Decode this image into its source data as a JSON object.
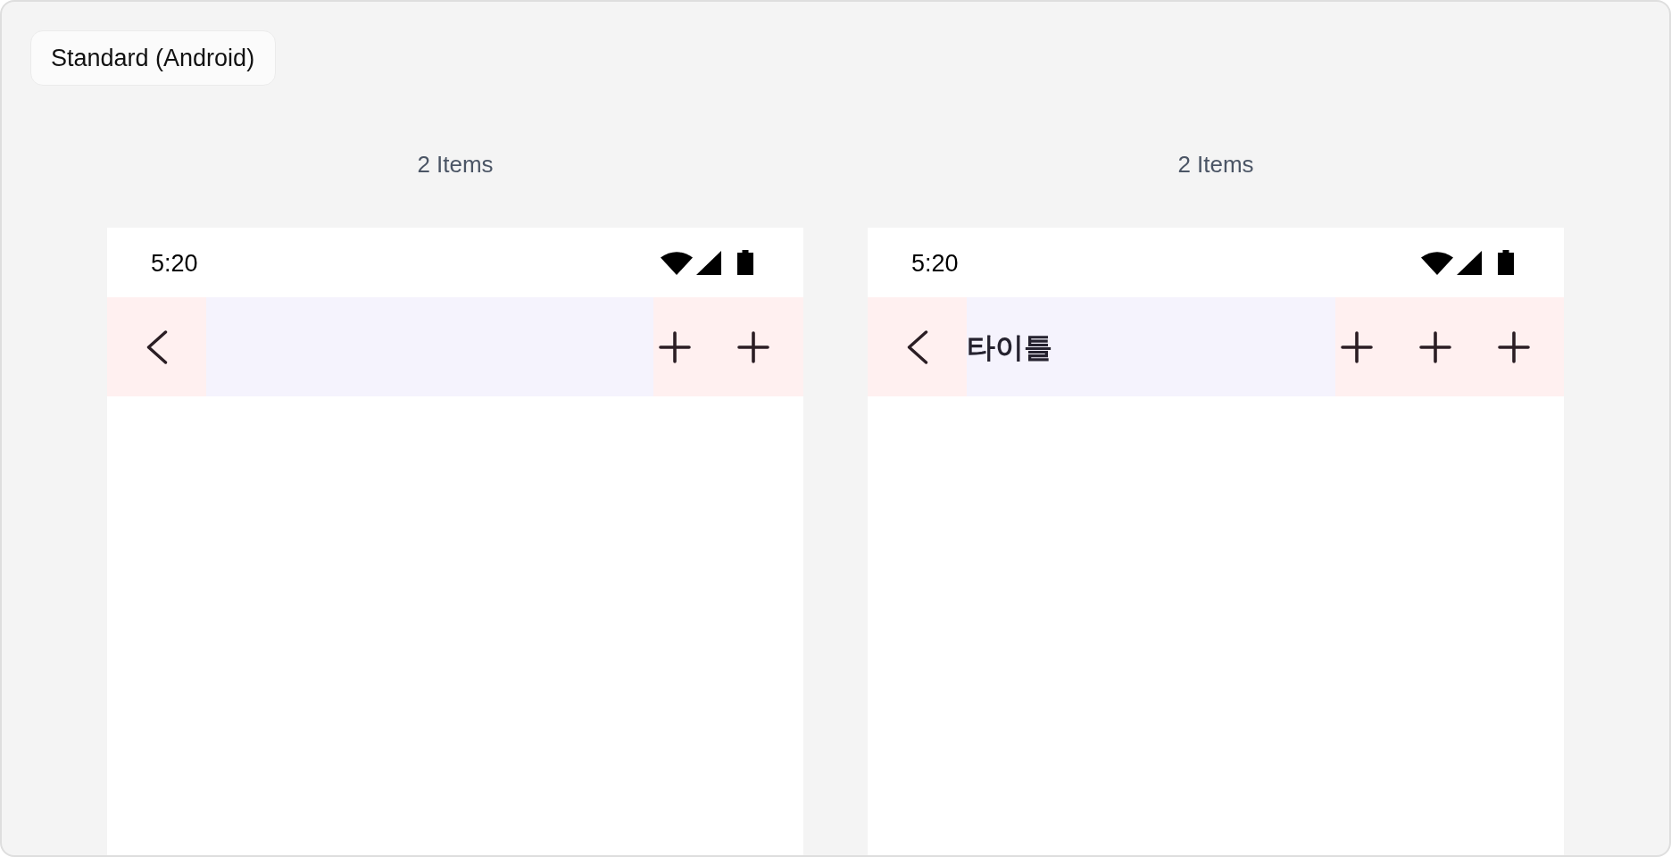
{
  "section_label": "Standard (Android)",
  "variants": [
    {
      "caption": "2 Items",
      "status_bar": {
        "time": "5:20"
      },
      "app_bar": {
        "navigation": {
          "kind": "back"
        },
        "actions": [
          {
            "kind": "plus"
          },
          {
            "kind": "plus"
          }
        ]
      }
    },
    {
      "caption": "2 Items",
      "status_bar": {
        "time": "5:20"
      },
      "app_bar": {
        "navigation": {
          "kind": "back"
        },
        "title": "타이틀",
        "actions": [
          {
            "kind": "plus"
          },
          {
            "kind": "plus"
          },
          {
            "kind": "plus"
          }
        ]
      }
    }
  ]
}
